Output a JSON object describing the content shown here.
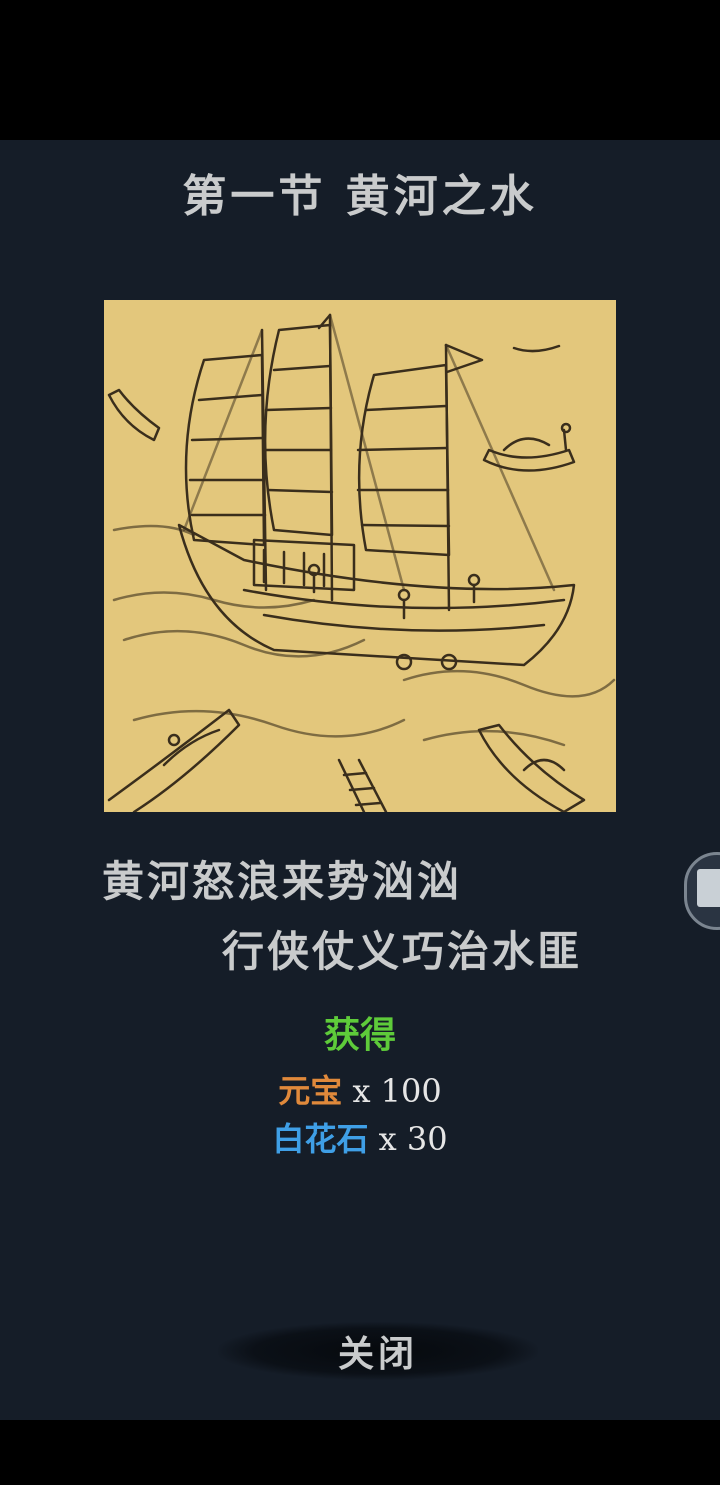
{
  "chapter": {
    "title": "第一节 黄河之水"
  },
  "poem": {
    "line1": "黄河怒浪来势汹汹",
    "line2": "行侠仗义巧治水匪"
  },
  "rewards": {
    "header": "获得",
    "items": [
      {
        "name": "元宝",
        "quantity": "x 100",
        "color": "#e0893b"
      },
      {
        "name": "白花石",
        "quantity": "x 30",
        "color": "#3f9fe6"
      }
    ]
  },
  "close_button": {
    "label": "关闭"
  },
  "colors": {
    "panel_bg": "#151d28",
    "text": "#c9cbcc",
    "reward_header": "#5ecb3a",
    "illustration_bg": "#e3c77c"
  }
}
